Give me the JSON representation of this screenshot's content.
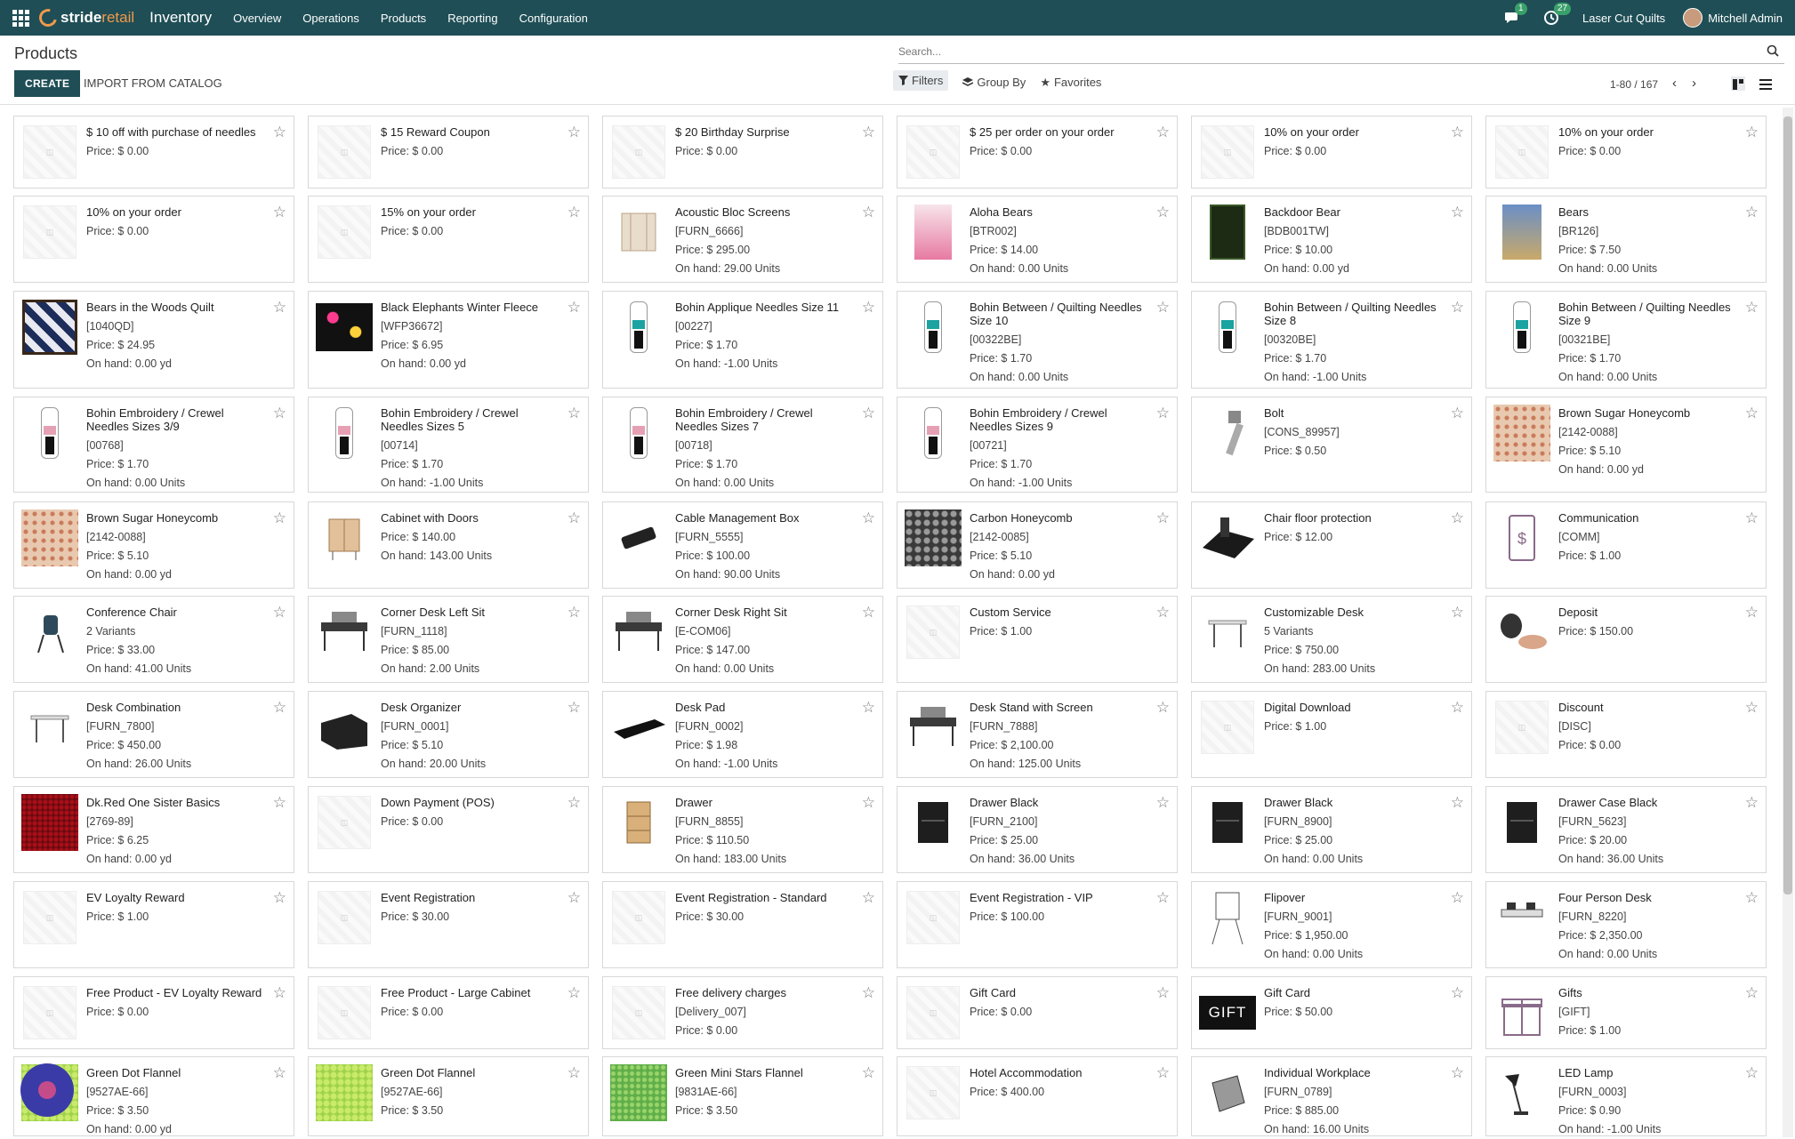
{
  "navbar": {
    "brand_a": "stride",
    "brand_b": "retail",
    "app_name": "Inventory",
    "menu": [
      "Overview",
      "Operations",
      "Products",
      "Reporting",
      "Configuration"
    ],
    "messages_badge": "1",
    "activities_badge": "27",
    "company": "Laser Cut Quilts",
    "user": "Mitchell Admin"
  },
  "control": {
    "title": "Products",
    "create_label": "CREATE",
    "import_label": "IMPORT FROM CATALOG",
    "search_placeholder": "Search...",
    "filters_label": "Filters",
    "groupby_label": "Group By",
    "favorites_label": "Favorites",
    "pager": "1-80 / 167"
  },
  "cards": [
    {
      "name": "$ 10 off with purchase of needles",
      "lines": [
        "Price: $ 0.00"
      ],
      "img": "placeholder"
    },
    {
      "name": "$ 15 Reward Coupon",
      "lines": [
        "Price: $ 0.00"
      ],
      "img": "placeholder"
    },
    {
      "name": "$ 20 Birthday Surprise",
      "lines": [
        "Price: $ 0.00"
      ],
      "img": "placeholder"
    },
    {
      "name": "$ 25 per order on your order",
      "lines": [
        "Price: $ 0.00"
      ],
      "img": "placeholder"
    },
    {
      "name": "10% on your order",
      "lines": [
        "Price: $ 0.00"
      ],
      "img": "placeholder"
    },
    {
      "name": "10% on your order",
      "lines": [
        "Price: $ 0.00"
      ],
      "img": "placeholder"
    },
    {
      "name": "10% on your order",
      "lines": [
        "Price: $ 0.00"
      ],
      "img": "placeholder"
    },
    {
      "name": "15% on your order",
      "lines": [
        "Price: $ 0.00"
      ],
      "img": "placeholder"
    },
    {
      "name": "Acoustic Bloc Screens",
      "lines": [
        "[FURN_6666]",
        "Price: $ 295.00",
        "On hand: 29.00 Units"
      ],
      "img": "screen"
    },
    {
      "name": "Aloha Bears",
      "lines": [
        "[BTR002]",
        "Price: $ 14.00",
        "On hand: 0.00 Units"
      ],
      "img": "fabric-pink"
    },
    {
      "name": "Backdoor Bear",
      "lines": [
        "[BDB001TW]",
        "Price: $ 10.00",
        "On hand: 0.00 yd"
      ],
      "img": "book-dark"
    },
    {
      "name": "Bears",
      "lines": [
        "[BR126]",
        "Price: $ 7.50",
        "On hand: 0.00 Units"
      ],
      "img": "book-blue"
    },
    {
      "name": "Bears in the Woods Quilt",
      "lines": [
        "[1040QD]",
        "Price: $ 24.95",
        "On hand: 0.00 yd"
      ],
      "img": "quilt"
    },
    {
      "name": "Black Elephants Winter Fleece",
      "lines": [
        "[WFP36672]",
        "Price: $ 6.95",
        "On hand: 0.00 yd"
      ],
      "img": "fleece"
    },
    {
      "name": "Bohin Applique Needles Size 11",
      "lines": [
        "[00227]",
        "Price: $ 1.70",
        "On hand: -1.00 Units"
      ],
      "img": "needle-teal"
    },
    {
      "name": "Bohin Between / Quilting Needles Size 10",
      "lines": [
        "[00322BE]",
        "Price: $ 1.70",
        "On hand: 0.00 Units"
      ],
      "img": "needle-teal"
    },
    {
      "name": "Bohin Between / Quilting Needles Size 8",
      "lines": [
        "[00320BE]",
        "Price: $ 1.70",
        "On hand: -1.00 Units"
      ],
      "img": "needle-teal"
    },
    {
      "name": "Bohin Between / Quilting Needles Size 9",
      "lines": [
        "[00321BE]",
        "Price: $ 1.70",
        "On hand: 0.00 Units"
      ],
      "img": "needle-teal"
    },
    {
      "name": "Bohin Embroidery / Crewel Needles Sizes 3/9",
      "lines": [
        "[00768]",
        "Price: $ 1.70",
        "On hand: 0.00 Units"
      ],
      "img": "needle-pink"
    },
    {
      "name": "Bohin Embroidery / Crewel Needles Sizes 5",
      "lines": [
        "[00714]",
        "Price: $ 1.70",
        "On hand: -1.00 Units"
      ],
      "img": "needle-pink"
    },
    {
      "name": "Bohin Embroidery / Crewel Needles Sizes 7",
      "lines": [
        "[00718]",
        "Price: $ 1.70",
        "On hand: 0.00 Units"
      ],
      "img": "needle-pink"
    },
    {
      "name": "Bohin Embroidery / Crewel Needles Sizes 9",
      "lines": [
        "[00721]",
        "Price: $ 1.70",
        "On hand: -1.00 Units"
      ],
      "img": "needle-pink"
    },
    {
      "name": "Bolt",
      "lines": [
        "[CONS_89957]",
        "Price: $ 0.50"
      ],
      "img": "bolt"
    },
    {
      "name": "Brown Sugar Honeycomb",
      "lines": [
        "[2142-0088]",
        "Price: $ 5.10",
        "On hand: 0.00 yd"
      ],
      "img": "honeycomb"
    },
    {
      "name": "Brown Sugar Honeycomb",
      "lines": [
        "[2142-0088]",
        "Price: $ 5.10",
        "On hand: 0.00 yd"
      ],
      "img": "honeycomb"
    },
    {
      "name": "Cabinet with Doors",
      "lines": [
        "Price: $ 140.00",
        "On hand: 143.00 Units"
      ],
      "img": "cabinet"
    },
    {
      "name": "Cable Management Box",
      "lines": [
        "[FURN_5555]",
        "Price: $ 100.00",
        "On hand: 90.00 Units"
      ],
      "img": "cable-box"
    },
    {
      "name": "Carbon Honeycomb",
      "lines": [
        "[2142-0085]",
        "Price: $ 5.10",
        "On hand: 0.00 yd"
      ],
      "img": "carbon"
    },
    {
      "name": "Chair floor protection",
      "lines": [
        "Price: $ 12.00"
      ],
      "img": "floor-mat"
    },
    {
      "name": "Communication",
      "lines": [
        "[COMM]",
        "Price: $ 1.00"
      ],
      "img": "phone"
    },
    {
      "name": "Conference Chair",
      "lines": [
        "2 Variants",
        "Price: $ 33.00",
        "On hand: 41.00 Units"
      ],
      "img": "chair"
    },
    {
      "name": "Corner Desk Left Sit",
      "lines": [
        "[FURN_1118]",
        "Price: $ 85.00",
        "On hand: 2.00 Units"
      ],
      "img": "desk"
    },
    {
      "name": "Corner Desk Right Sit",
      "lines": [
        "[E-COM06]",
        "Price: $ 147.00",
        "On hand: 0.00 Units"
      ],
      "img": "desk"
    },
    {
      "name": "Custom Service",
      "lines": [
        "Price: $ 1.00"
      ],
      "img": "placeholder"
    },
    {
      "name": "Customizable Desk",
      "lines": [
        "5 Variants",
        "Price: $ 750.00",
        "On hand: 283.00 Units"
      ],
      "img": "table"
    },
    {
      "name": "Deposit",
      "lines": [
        "Price: $ 150.00"
      ],
      "img": "hands"
    },
    {
      "name": "Desk Combination",
      "lines": [
        "[FURN_7800]",
        "Price: $ 450.00",
        "On hand: 26.00 Units"
      ],
      "img": "table"
    },
    {
      "name": "Desk Organizer",
      "lines": [
        "[FURN_0001]",
        "Price: $ 5.10",
        "On hand: 20.00 Units"
      ],
      "img": "organizer"
    },
    {
      "name": "Desk Pad",
      "lines": [
        "[FURN_0002]",
        "Price: $ 1.98",
        "On hand: -1.00 Units"
      ],
      "img": "pad"
    },
    {
      "name": "Desk Stand with Screen",
      "lines": [
        "[FURN_7888]",
        "Price: $ 2,100.00",
        "On hand: 125.00 Units"
      ],
      "img": "desk"
    },
    {
      "name": "Digital Download",
      "lines": [
        "Price: $ 1.00"
      ],
      "img": "placeholder"
    },
    {
      "name": "Discount",
      "lines": [
        "[DISC]",
        "Price: $ 0.00"
      ],
      "img": "placeholder"
    },
    {
      "name": "Dk.Red One Sister Basics",
      "lines": [
        "[2769-89]",
        "Price: $ 6.25",
        "On hand: 0.00 yd"
      ],
      "img": "red-fabric"
    },
    {
      "name": "Down Payment (POS)",
      "lines": [
        "Price: $ 0.00"
      ],
      "img": "placeholder"
    },
    {
      "name": "Drawer",
      "lines": [
        "[FURN_8855]",
        "Price: $ 110.50",
        "On hand: 183.00 Units"
      ],
      "img": "drawer-wood"
    },
    {
      "name": "Drawer Black",
      "lines": [
        "[FURN_2100]",
        "Price: $ 25.00",
        "On hand: 36.00 Units"
      ],
      "img": "drawer-black"
    },
    {
      "name": "Drawer Black",
      "lines": [
        "[FURN_8900]",
        "Price: $ 25.00",
        "On hand: 0.00 Units"
      ],
      "img": "drawer-black"
    },
    {
      "name": "Drawer Case Black",
      "lines": [
        "[FURN_5623]",
        "Price: $ 20.00",
        "On hand: 36.00 Units"
      ],
      "img": "drawer-black"
    },
    {
      "name": "EV Loyalty Reward",
      "lines": [
        "Price: $ 1.00"
      ],
      "img": "placeholder"
    },
    {
      "name": "Event Registration",
      "lines": [
        "Price: $ 30.00"
      ],
      "img": "placeholder"
    },
    {
      "name": "Event Registration - Standard",
      "lines": [
        "Price: $ 30.00"
      ],
      "img": "placeholder"
    },
    {
      "name": "Event Registration - VIP",
      "lines": [
        "Price: $ 100.00"
      ],
      "img": "placeholder"
    },
    {
      "name": "Flipover",
      "lines": [
        "[FURN_9001]",
        "Price: $ 1,950.00",
        "On hand: 0.00 Units"
      ],
      "img": "flipover"
    },
    {
      "name": "Four Person Desk",
      "lines": [
        "[FURN_8220]",
        "Price: $ 2,350.00",
        "On hand: 0.00 Units"
      ],
      "img": "four-desk"
    },
    {
      "name": "Free Product - EV Loyalty Reward",
      "lines": [
        "Price: $ 0.00"
      ],
      "img": "placeholder"
    },
    {
      "name": "Free Product - Large Cabinet",
      "lines": [
        "Price: $ 0.00"
      ],
      "img": "placeholder"
    },
    {
      "name": "Free delivery charges",
      "lines": [
        "[Delivery_007]",
        "Price: $ 0.00"
      ],
      "img": "placeholder"
    },
    {
      "name": "Gift Card",
      "lines": [
        "Price: $ 0.00"
      ],
      "img": "placeholder"
    },
    {
      "name": "Gift Card",
      "lines": [
        "Price: $ 50.00"
      ],
      "img": "giftcard",
      "img_text": "GIFT"
    },
    {
      "name": "Gifts",
      "lines": [
        "[GIFT]",
        "Price: $ 1.00"
      ],
      "img": "gift"
    },
    {
      "name": "Green Dot Flannel",
      "lines": [
        "[9527AE-66]",
        "Price: $ 3.50",
        "On hand: 0.00 yd"
      ],
      "img": "green"
    },
    {
      "name": "Green Dot Flannel",
      "lines": [
        "[9527AE-66]",
        "Price: $ 3.50"
      ],
      "img": "green"
    },
    {
      "name": "Green Mini Stars Flannel",
      "lines": [
        "[9831AE-66]",
        "Price: $ 3.50"
      ],
      "img": "green-dark"
    },
    {
      "name": "Hotel Accommodation",
      "lines": [
        "Price: $ 400.00"
      ],
      "img": "placeholder"
    },
    {
      "name": "Individual Workplace",
      "lines": [
        "[FURN_0789]",
        "Price: $ 885.00",
        "On hand: 16.00 Units"
      ],
      "img": "workplace"
    },
    {
      "name": "LED Lamp",
      "lines": [
        "[FURN_0003]",
        "Price: $ 0.90",
        "On hand: -1.00 Units"
      ],
      "img": "lamp"
    }
  ]
}
